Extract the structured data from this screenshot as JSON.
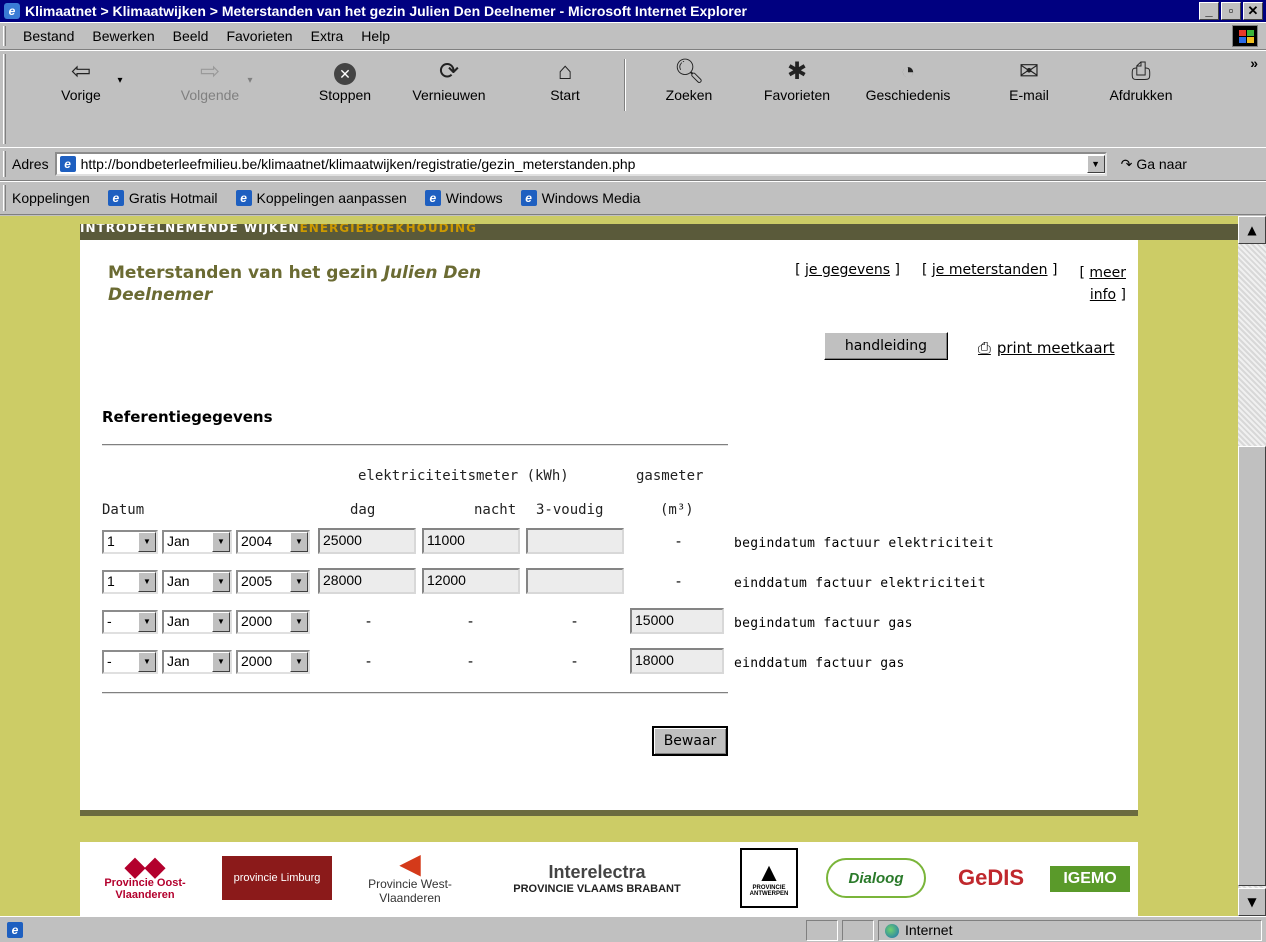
{
  "window": {
    "title": "Klimaatnet > Klimaatwijken > Meterstanden van het gezin Julien Den Deelnemer - Microsoft Internet Explorer",
    "controls": [
      "_",
      "▫",
      "✕"
    ]
  },
  "menu": [
    {
      "label": "Bestand",
      "icon": ""
    },
    {
      "label": "Bewerken",
      "icon": ""
    },
    {
      "label": "Beeld",
      "icon": ""
    },
    {
      "label": "Favorieten",
      "icon": ""
    },
    {
      "label": "Extra",
      "icon": ""
    },
    {
      "label": "Help",
      "icon": ""
    }
  ],
  "toolbar": {
    "back": {
      "label": "Vorige",
      "icon": "back-arrow-icon"
    },
    "forward": {
      "label": "Volgende",
      "icon": "forward-arrow-icon"
    },
    "stop": {
      "label": "Stoppen",
      "icon": "stop-icon"
    },
    "refresh": {
      "label": "Vernieuwen",
      "icon": "refresh-icon"
    },
    "home": {
      "label": "Start",
      "icon": "home-icon"
    },
    "search": {
      "label": "Zoeken",
      "icon": "search-icon"
    },
    "favorites": {
      "label": "Favorieten",
      "icon": "favorites-icon"
    },
    "history": {
      "label": "Geschiedenis",
      "icon": "history-icon"
    },
    "mail": {
      "label": "E-mail",
      "icon": "mail-icon"
    },
    "print": {
      "label": "Afdrukken",
      "icon": "print-icon"
    }
  },
  "address": {
    "label": "Adres",
    "url": "http://bondbeterleefmilieu.be/klimaatnet/klimaatwijken/registratie/gezin_meterstanden.php",
    "go": "Ga naar"
  },
  "links": {
    "label": "Koppelingen",
    "items": [
      "Gratis Hotmail",
      "Koppelingen aanpassen",
      "Windows",
      "Windows Media"
    ]
  },
  "banner": {
    "left": "INTRODEELNEMENDE WIJKEN",
    "right": "ENERGIEBOEKHOUDING"
  },
  "page": {
    "heading_prefix": "Meterstanden van het gezin",
    "heading_name": "Julien Den Deelnemer",
    "nav": {
      "gegevens": "je gegevens",
      "meterstanden": "je meterstanden",
      "meer": "meer",
      "info": "info"
    },
    "handleiding": "handleiding",
    "print_meetkaart": "print meetkaart",
    "section_title": "Referentiegegevens",
    "headers": {
      "elektriciteit": "elektriciteitsmeter (kWh)",
      "gasmeter": "gasmeter",
      "datum": "Datum",
      "dag": "dag",
      "nacht": "nacht",
      "drievoudig": "3-voudig",
      "m3": "(m³)"
    },
    "rows": [
      {
        "day": "1",
        "month": "Jan",
        "year": "2004",
        "dag": "25000",
        "nacht": "11000",
        "drievoudig": "",
        "gas": "-",
        "label": "begindatum factuur elektriciteit"
      },
      {
        "day": "1",
        "month": "Jan",
        "year": "2005",
        "dag": "28000",
        "nacht": "12000",
        "drievoudig": "",
        "gas": "-",
        "label": "einddatum factuur elektriciteit"
      },
      {
        "day": "-",
        "month": "Jan",
        "year": "2000",
        "dag": "-",
        "nacht": "-",
        "drievoudig": "-",
        "gas": "15000",
        "label": "begindatum factuur gas"
      },
      {
        "day": "-",
        "month": "Jan",
        "year": "2000",
        "dag": "-",
        "nacht": "-",
        "drievoudig": "-",
        "gas": "18000",
        "label": "einddatum factuur gas"
      }
    ],
    "save": "Bewaar"
  },
  "footer_logos": [
    "Provincie Oost-Vlaanderen",
    "provincie Limburg",
    "Provincie West-Vlaanderen",
    "Interelectra",
    "PROVINCIE VLAAMS BRABANT",
    "PROVINCIE ANTWERPEN",
    "Dialoog",
    "GeDIS",
    "IGEMO"
  ],
  "status": {
    "zone": "Internet"
  }
}
